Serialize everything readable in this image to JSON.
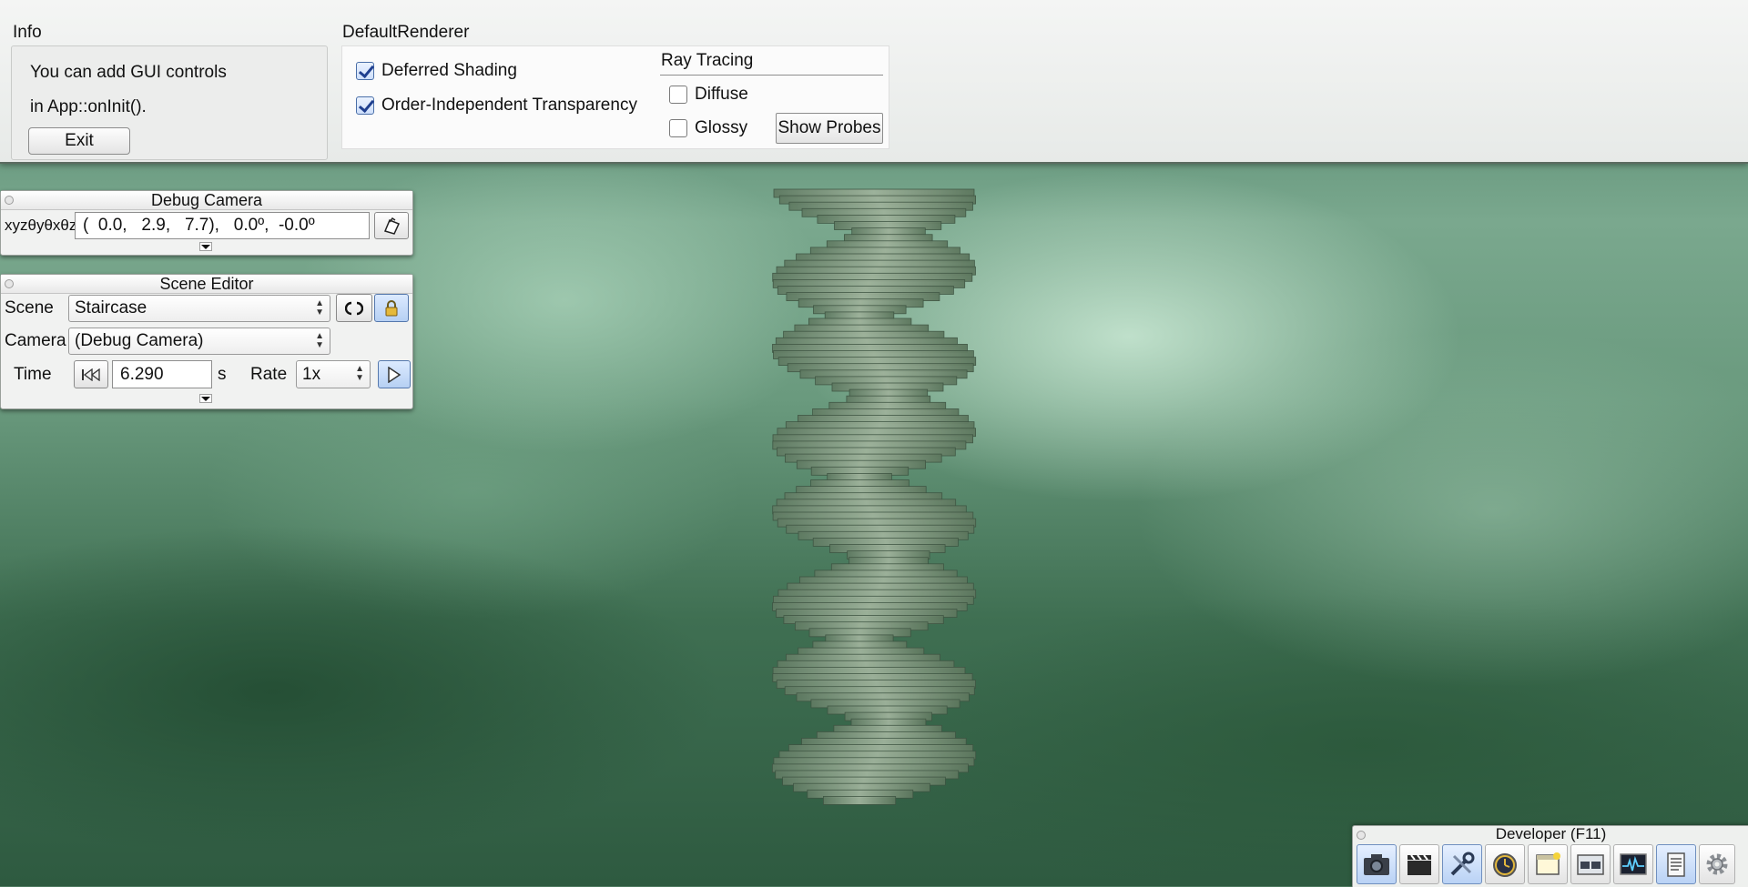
{
  "info": {
    "title": "Info",
    "line1": "You can add GUI controls",
    "line2": "in App::onInit().",
    "exit_label": "Exit"
  },
  "renderer": {
    "title": "DefaultRenderer",
    "deferred_label": "Deferred Shading",
    "deferred_checked": true,
    "oit_label": "Order-Independent Transparency",
    "oit_checked": true,
    "ray_tracing_title": "Ray Tracing",
    "diffuse_label": "Diffuse",
    "diffuse_checked": false,
    "glossy_label": "Glossy",
    "glossy_checked": false,
    "show_probes_label": "Show Probes"
  },
  "debug_camera": {
    "title": "Debug Camera",
    "coord_label": "xyzθyθxθz",
    "value": "(  0.0,   2.9,   7.7),   0.0º,  -0.0º"
  },
  "scene_editor": {
    "title": "Scene Editor",
    "scene_label": "Scene",
    "scene_value": "Staircase",
    "camera_label": "Camera",
    "camera_value": "(Debug Camera)",
    "time_label": "Time",
    "time_value": "6.290",
    "time_unit": "s",
    "rate_label": "Rate",
    "rate_value": "1x"
  },
  "developer": {
    "title": "Developer (F11)",
    "tools": [
      "camera-icon",
      "clapperboard-icon",
      "wrench-icon",
      "clock-icon",
      "window-icon",
      "scene-icon",
      "profiler-icon",
      "log-icon",
      "gear-icon"
    ]
  },
  "colors": {
    "sky_light": "#cfe6d6",
    "sky_dark": "#2e5a40",
    "accent_blue": "#b6d0f3"
  }
}
